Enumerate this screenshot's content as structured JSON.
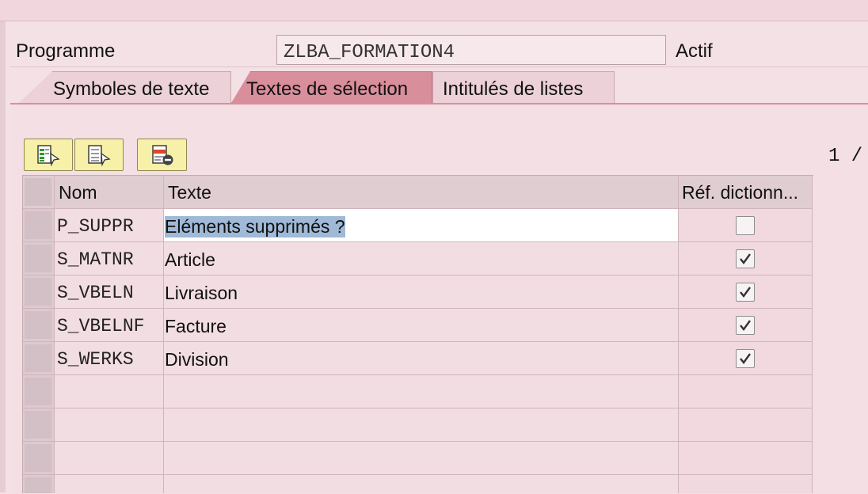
{
  "header": {
    "program_label": "Programme",
    "program_value": "ZLBA_FORMATION4",
    "status": "Actif"
  },
  "tabs": [
    {
      "label": "Symboles de texte",
      "active": false
    },
    {
      "label": "Textes de sélection",
      "active": true
    },
    {
      "label": "Intitulés de listes",
      "active": false
    }
  ],
  "toolbar": {
    "buttons": [
      {
        "icon": "document-select-icon"
      },
      {
        "icon": "document-deselect-icon"
      },
      {
        "icon": "delete-row-icon"
      }
    ],
    "page_indicator": "1 /"
  },
  "table": {
    "columns": [
      "Nom",
      "Texte",
      "Réf. dictionn..."
    ],
    "rows": [
      {
        "nom": "P_SUPPR",
        "texte": "Eléments supprimés ?",
        "ref": false,
        "editing": true
      },
      {
        "nom": "S_MATNR",
        "texte": "Article",
        "ref": true
      },
      {
        "nom": "S_VBELN",
        "texte": "Livraison",
        "ref": true
      },
      {
        "nom": "S_VBELNF",
        "texte": "Facture",
        "ref": true
      },
      {
        "nom": "S_WERKS",
        "texte": "Division",
        "ref": true
      }
    ],
    "empty_rows": 4
  },
  "colors": {
    "background": "#f4e1e6",
    "active_tab": "#d98e9c",
    "toolbar_button": "#f6f0a8",
    "selection_highlight": "#9fb9d6"
  }
}
